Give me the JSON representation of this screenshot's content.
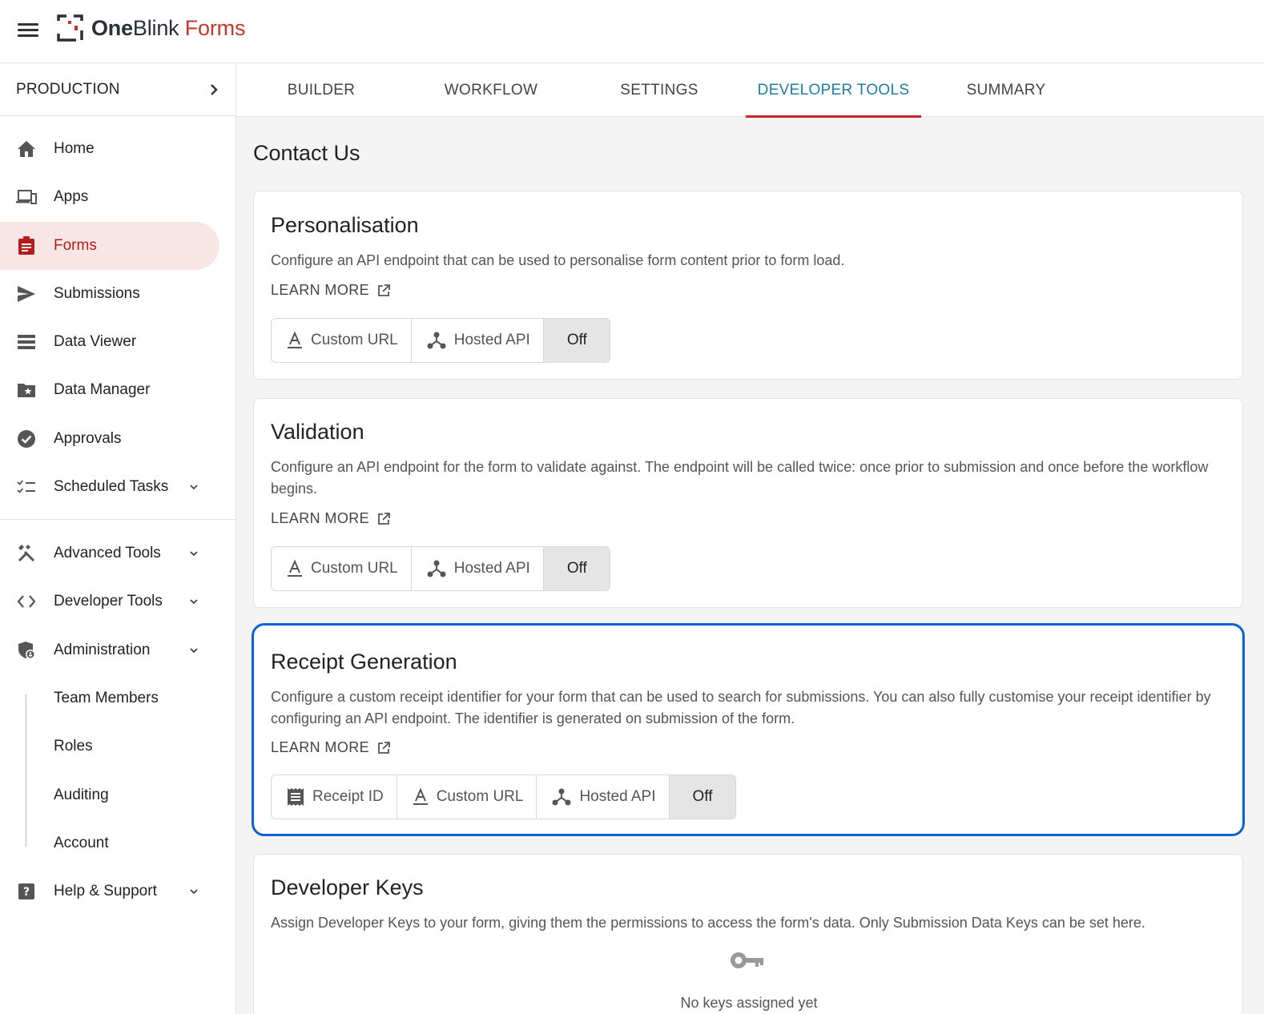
{
  "header": {
    "logo_one": "One",
    "logo_blink": "Blink",
    "logo_forms": " Forms"
  },
  "sidebar": {
    "environment": "PRODUCTION",
    "items": [
      {
        "label": "Home",
        "icon": "home-icon"
      },
      {
        "label": "Apps",
        "icon": "devices-icon"
      },
      {
        "label": "Forms",
        "icon": "clipboard-icon",
        "active": true
      },
      {
        "label": "Submissions",
        "icon": "send-icon"
      },
      {
        "label": "Data Viewer",
        "icon": "storage-icon"
      },
      {
        "label": "Data Manager",
        "icon": "folder-star-icon"
      },
      {
        "label": "Approvals",
        "icon": "check-circle-icon"
      },
      {
        "label": "Scheduled Tasks",
        "icon": "checklist-icon"
      },
      {
        "label": "Advanced Tools",
        "icon": "tools-icon"
      },
      {
        "label": "Developer Tools",
        "icon": "code-icon"
      },
      {
        "label": "Administration",
        "icon": "admin-shield-icon"
      },
      {
        "label": "Team Members"
      },
      {
        "label": "Roles"
      },
      {
        "label": "Auditing"
      },
      {
        "label": "Account"
      },
      {
        "label": "Help & Support",
        "icon": "help-icon"
      }
    ]
  },
  "tabs": [
    {
      "label": "BUILDER"
    },
    {
      "label": "WORKFLOW"
    },
    {
      "label": "SETTINGS"
    },
    {
      "label": "DEVELOPER TOOLS",
      "active": true
    },
    {
      "label": "SUMMARY"
    }
  ],
  "main": {
    "title": "Contact Us",
    "personalisation": {
      "title": "Personalisation",
      "description": "Configure an API endpoint that can be used to personalise form content prior to form load.",
      "learn_more": "LEARN MORE",
      "options": [
        "Custom URL",
        "Hosted API",
        "Off"
      ],
      "selected": "Off"
    },
    "validation": {
      "title": "Validation",
      "description": "Configure an API endpoint for the form to validate against. The endpoint will be called twice: once prior to submission and once before the workflow begins.",
      "learn_more": "LEARN MORE",
      "options": [
        "Custom URL",
        "Hosted API",
        "Off"
      ],
      "selected": "Off"
    },
    "receipt": {
      "title": "Receipt Generation",
      "description": "Configure a custom receipt identifier for your form that can be used to search for submissions. You can also fully customise your receipt identifier by configuring an API endpoint. The identifier is generated on submission of the form.",
      "learn_more": "LEARN MORE",
      "options": [
        "Receipt ID",
        "Custom URL",
        "Hosted API",
        "Off"
      ],
      "selected": "Off"
    },
    "developer_keys": {
      "title": "Developer Keys",
      "description": "Assign Developer Keys to your form, giving them the permissions to access the form's data. Only Submission Data Keys can be set here.",
      "empty_text": "No keys assigned yet"
    }
  },
  "colors": {
    "brand_red": "#c0392b",
    "active_tab_text": "#1e7fa0",
    "active_tab_underline": "#c62828",
    "highlight_border": "#0b61d8",
    "active_nav_bg": "#f8e6e6"
  }
}
